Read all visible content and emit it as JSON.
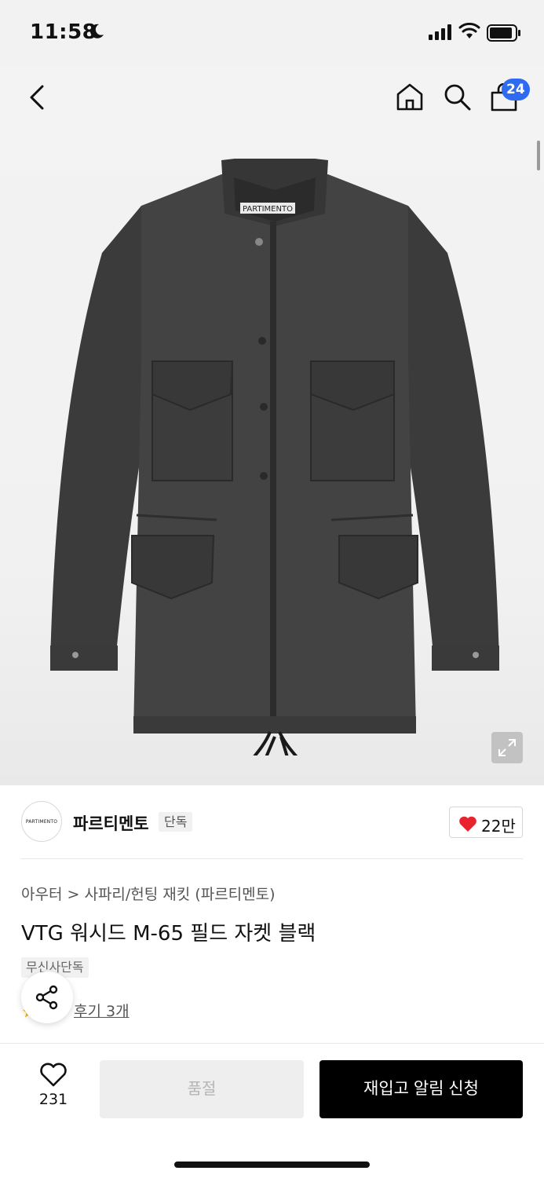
{
  "status_bar": {
    "time": "11:58"
  },
  "header": {
    "cart_count": "24"
  },
  "product_image": {
    "label_text": "PARTIMENTO"
  },
  "brand": {
    "logo_text": "PARTIMENTO",
    "name": "파르티멘토",
    "tag": "단독",
    "likes": "22만"
  },
  "breadcrumb": {
    "category": "아우터",
    "separator": ">",
    "subcategory": "사파리/헌팅 재킷 (파르티멘토)"
  },
  "product": {
    "title": "VTG 워시드 M-65 필드 자켓 블랙",
    "badge": "무신사단독",
    "reviews": "후기 3개"
  },
  "bottom_bar": {
    "wish_count": "231",
    "soldout_label": "품절",
    "restock_label": "재입고 알림 신청"
  },
  "colors": {
    "accent_blue": "#2f6bf1",
    "heart_red": "#e8232e",
    "cta_black": "#000000"
  },
  "icons": [
    "back-icon",
    "home-icon",
    "search-icon",
    "shopping-bag-icon",
    "expand-icon",
    "heart-icon",
    "star-icon",
    "share-icon"
  ]
}
